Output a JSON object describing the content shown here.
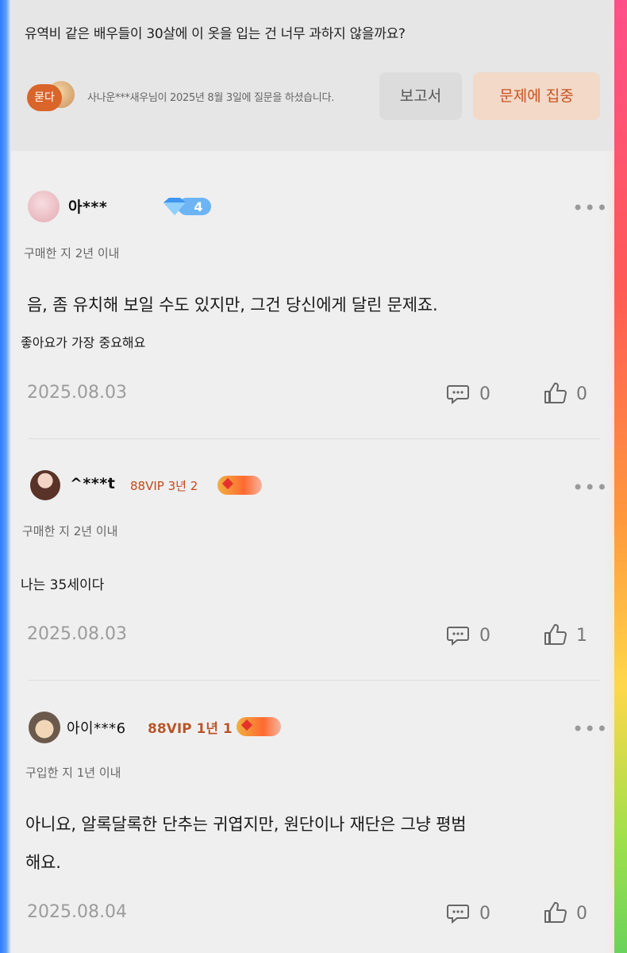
{
  "question": {
    "text": "유역비 같은 배우들이 30살에 이 옷을 입는 건 너무 과하지 않을까요?",
    "ask_badge": "묻다",
    "meta": "사나운***새우님이 2025년 8월 3일에 질문을 하셨습니다.",
    "report_label": "보고서",
    "focus_label": "문제에 집중"
  },
  "reviews": [
    {
      "user": "아***",
      "level": "4",
      "purchase": "구매한 지 2년 이내",
      "text": "음, 좀 유치해 보일 수도 있지만, 그건 당신에게 달린 문제죠.",
      "subtext": "좋아요가 가장 중요해요",
      "date": "2025.08.03",
      "comments": "0",
      "likes": "0"
    },
    {
      "user": "^***t",
      "vip": "88VIP 3년 2",
      "purchase": "구매한 지 2년 이내",
      "text": "나는 35세이다",
      "date": "2025.08.03",
      "comments": "0",
      "likes": "1"
    },
    {
      "user": "아이***6",
      "vip": "88VIP 1년 1",
      "purchase": "구입한 지 1년 이내",
      "text_line1": "아니요, 알록달록한 단추는 귀엽지만, 원단이나 재단은 그냥 평범",
      "text_line2": "해요.",
      "date": "2025.08.04",
      "comments": "0",
      "likes": "0"
    }
  ],
  "more_glyph": "•••",
  "colors": {
    "accent": "#c9521e",
    "vip": "#c24a1c",
    "diamond": "#5aa8f0"
  }
}
